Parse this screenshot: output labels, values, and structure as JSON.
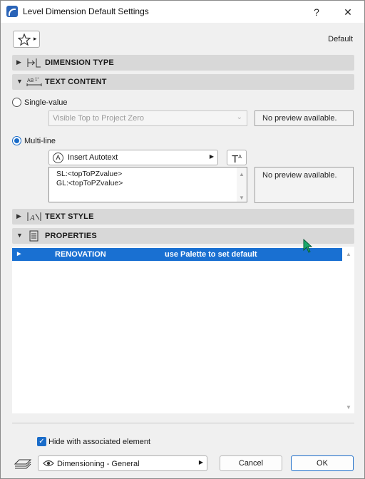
{
  "window": {
    "title": "Level Dimension Default Settings",
    "help_label": "?",
    "close_label": "✕"
  },
  "header": {
    "default_label": "Default",
    "favorites_arrow": "▸"
  },
  "sections": {
    "dimension_type": {
      "title": "DIMENSION TYPE",
      "expanded": false
    },
    "text_content": {
      "title": "TEXT CONTENT",
      "expanded": true
    },
    "text_style": {
      "title": "TEXT STYLE",
      "expanded": false
    },
    "properties": {
      "title": "PROPERTIES",
      "expanded": true
    }
  },
  "text_content": {
    "single_value": {
      "label": "Single-value",
      "selected": false,
      "dropdown_value": "Visible Top to Project Zero",
      "preview": "No preview available."
    },
    "multi_line": {
      "label": "Multi-line",
      "selected": true,
      "autotext_label": "Insert Autotext",
      "lines": [
        "SL:<topToPZvalue>",
        "GL:<topToPZvalue>"
      ],
      "preview": "No preview available."
    }
  },
  "properties": {
    "rows": [
      {
        "name": "RENOVATION",
        "value": "use Palette to set default",
        "selected": true
      }
    ]
  },
  "footer": {
    "hide_checkbox_label": "Hide with associated element",
    "hide_checked": true,
    "layer_label": "Dimensioning - General",
    "cancel_label": "Cancel",
    "ok_label": "OK"
  },
  "colors": {
    "accent": "#1970d2",
    "section_bg": "#d8d8d8",
    "window_bg": "#f0f0f0"
  }
}
